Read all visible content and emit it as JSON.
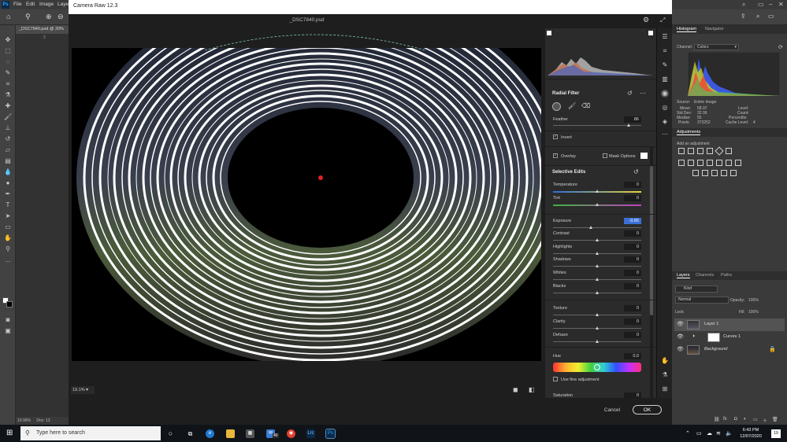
{
  "ps": {
    "logo": "Ps",
    "menu": [
      "File",
      "Edit",
      "Image",
      "Laye"
    ],
    "doc_tab": "_DSC7840.psd @ 20%",
    "status_zoom": "19.96%",
    "status_doc": "Doc: 13",
    "ruler_mark": "2"
  },
  "camera_raw": {
    "title": "Camera Raw 12.3",
    "filename": "_DSC7840.psd",
    "zoom": "19.1%",
    "radial_filter": {
      "title": "Radial Filter",
      "feather_label": "Feather",
      "feather_value": "86",
      "feather_fraction": 0.86,
      "invert_label": "Invert",
      "invert_checked": true,
      "overlay_label": "Overlay",
      "overlay_checked": true,
      "mask_options_label": "Mask Options"
    },
    "selective_edits": {
      "title": "Selective Edits",
      "sliders": [
        {
          "label": "Temperature",
          "value": "0",
          "pos": 0.5,
          "gradient": "linear-gradient(90deg,#2b6fd6,#e7d43b)"
        },
        {
          "label": "Tint",
          "value": "0",
          "pos": 0.5,
          "gradient": "linear-gradient(90deg,#3fb23f,#c040c0)"
        },
        {
          "label": "Exposure",
          "value": "-0.65",
          "pos": 0.43,
          "active": true
        },
        {
          "label": "Contrast",
          "value": "0",
          "pos": 0.5
        },
        {
          "label": "Highlights",
          "value": "0",
          "pos": 0.5
        },
        {
          "label": "Shadows",
          "value": "0",
          "pos": 0.5
        },
        {
          "label": "Whites",
          "value": "0",
          "pos": 0.5
        },
        {
          "label": "Blacks",
          "value": "0",
          "pos": 0.5
        },
        {
          "label": "Texture",
          "value": "0",
          "pos": 0.5
        },
        {
          "label": "Clarity",
          "value": "0",
          "pos": 0.5
        },
        {
          "label": "Dehaze",
          "value": "0",
          "pos": 0.5
        }
      ],
      "hue_label": "Hue",
      "hue_value": "0.0",
      "fine_adjust_label": "Use fine adjustment",
      "saturation_label": "Saturation",
      "saturation_value": "0"
    },
    "cancel_label": "Cancel",
    "ok_label": "OK"
  },
  "panels": {
    "histogram_tab": "Histogram",
    "navigator_tab": "Navigator",
    "channel_label": "Channel:",
    "channel_value": "Colors",
    "source_label": "Source:",
    "source_value": "Entire Image",
    "stats_left": [
      {
        "k": "Mean:",
        "v": "58.97"
      },
      {
        "k": "Std Dev:",
        "v": "32.06"
      },
      {
        "k": "Median:",
        "v": "55"
      },
      {
        "k": "Pixels:",
        "v": "373252"
      }
    ],
    "stats_right": [
      "Level:",
      "Count:",
      "Percentile:",
      "Cache Level:"
    ],
    "cache_level_value": "4",
    "adjustments_title": "Adjustments",
    "add_adjustment": "Add an adjustment",
    "layers_tab": "Layers",
    "channels_tab": "Channels",
    "paths_tab": "Paths",
    "kind_label": "Kind",
    "blend_mode": "Normal",
    "opacity_label": "Opacity:",
    "opacity_value": "100%",
    "lock_label": "Lock:",
    "fill_label": "Fill:",
    "fill_value": "100%",
    "layers": [
      {
        "name": "Layer 1",
        "selected": true
      },
      {
        "name": "Curves 1",
        "selected": false
      },
      {
        "name": "Background",
        "selected": false
      }
    ]
  },
  "taskbar": {
    "search_placeholder": "Type here to search",
    "mail_badge": "40",
    "lr_label": "Lrc",
    "ps_label": "Ps",
    "time": "6:43 PM",
    "date": "12/07/2020",
    "notifications": "19"
  },
  "colors": {
    "accent_blue": "#3b6fd4",
    "ps_blue": "#31a8ff",
    "filter_pin": "#e02020"
  }
}
